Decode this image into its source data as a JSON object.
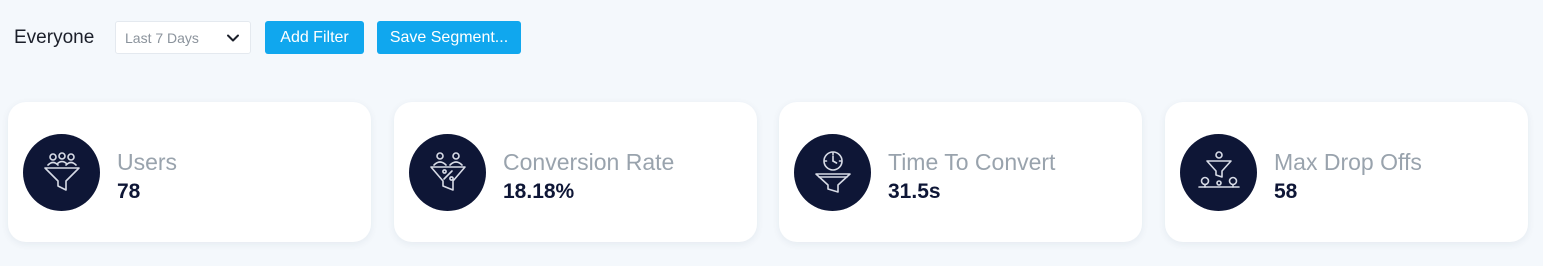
{
  "toolbar": {
    "segment": "Everyone",
    "date_range": {
      "selected": "Last 7 Days"
    },
    "add_filter_label": "Add Filter",
    "save_segment_label": "Save Segment..."
  },
  "cards": [
    {
      "label": "Users",
      "value": "78",
      "icon": "users-funnel-icon"
    },
    {
      "label": "Conversion Rate",
      "value": "18.18%",
      "icon": "conversion-funnel-icon"
    },
    {
      "label": "Time To Convert",
      "value": "31.5s",
      "icon": "clock-funnel-icon"
    },
    {
      "label": "Max Drop Offs",
      "value": "58",
      "icon": "drop-off-funnel-icon"
    }
  ],
  "colors": {
    "page_background": "#f4f8fc",
    "primary_button": "#10a7ee",
    "icon_background": "#0e1636",
    "metric_label": "#99a3ad",
    "metric_value": "#0e1636"
  }
}
